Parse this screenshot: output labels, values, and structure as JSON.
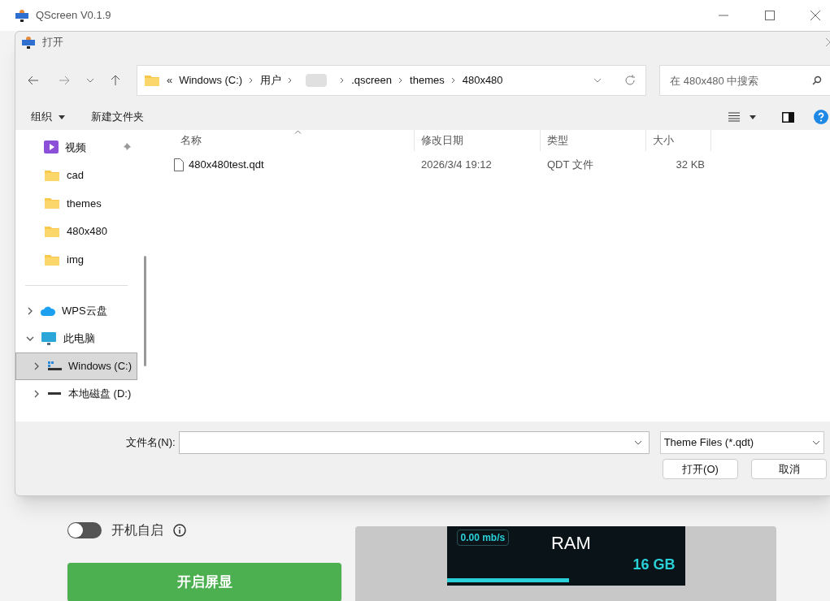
{
  "app": {
    "title": "QScreen V0.1.9",
    "autostart": {
      "label": "开机自启",
      "on": false
    },
    "start_button": "开启屏显",
    "preview": {
      "speed": "0.00 mb/s",
      "gauge_label": "RAM",
      "gauge_value": "16 GB"
    }
  },
  "dialog": {
    "title": "打开",
    "path": {
      "overflow": "«",
      "segments": [
        {
          "kind": "text",
          "label": "Windows (C:)"
        },
        {
          "kind": "text",
          "label": "用户"
        },
        {
          "kind": "redacted"
        },
        {
          "kind": "text",
          "label": ".qscreen"
        },
        {
          "kind": "text",
          "label": "themes"
        },
        {
          "kind": "text",
          "label": "480x480"
        }
      ]
    },
    "search": {
      "placeholder": "在 480x480 中搜索"
    },
    "toolbar": {
      "organize": "组织",
      "new_folder": "新建文件夹"
    },
    "quick_access": [
      {
        "kind": "video",
        "label": "视频",
        "pinned": true,
        "selected": false
      },
      {
        "kind": "folder",
        "label": "cad",
        "pinned": false,
        "selected": false
      },
      {
        "kind": "folder",
        "label": "themes",
        "pinned": false,
        "selected": false
      },
      {
        "kind": "folder",
        "label": "480x480",
        "pinned": false,
        "selected": false
      },
      {
        "kind": "folder",
        "label": "img",
        "pinned": false,
        "selected": false
      }
    ],
    "tree": [
      {
        "kind": "cloud",
        "label": "WPS云盘",
        "expanded": false,
        "selected": false
      },
      {
        "kind": "pc",
        "label": "此电脑",
        "expanded": true,
        "selected": false,
        "children": [
          {
            "kind": "system-drive",
            "label": "Windows (C:)",
            "expanded": false,
            "selected": true
          },
          {
            "kind": "drive",
            "label": "本地磁盘 (D:)",
            "expanded": false,
            "selected": false
          }
        ]
      }
    ],
    "columns": [
      {
        "label": "名称",
        "sorted": true
      },
      {
        "label": "修改日期",
        "sorted": false
      },
      {
        "label": "类型",
        "sorted": false
      },
      {
        "label": "大小",
        "sorted": false
      }
    ],
    "files": [
      {
        "name": "480x480test.qdt",
        "modified": "2026/3/4 19:12",
        "type": "QDT 文件",
        "size": "32 KB",
        "selected": false
      }
    ],
    "filename_label": "文件名(N):",
    "filter": "Theme Files (*.qdt)",
    "buttons": [
      "打开(O)",
      "取消"
    ]
  }
}
